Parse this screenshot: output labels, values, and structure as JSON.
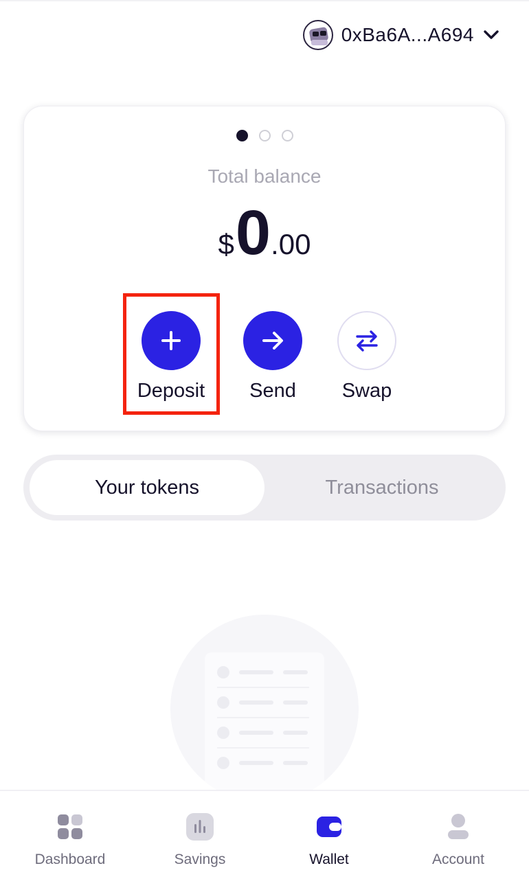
{
  "header": {
    "wallet_address": "0xBa6A...A694",
    "avatar_icon": "nft-avatar-icon",
    "dropdown_icon": "chevron-down-icon"
  },
  "balance_card": {
    "carousel_pages": 3,
    "carousel_active": 1,
    "label": "Total balance",
    "currency": "$",
    "integer": "0",
    "decimal": ".00",
    "actions": [
      {
        "label": "Deposit",
        "icon": "plus-icon"
      },
      {
        "label": "Send",
        "icon": "arrow-right-icon"
      },
      {
        "label": "Swap",
        "icon": "swap-arrows-icon"
      }
    ]
  },
  "tabs": {
    "items": [
      {
        "label": "Your tokens",
        "active": true
      },
      {
        "label": "Transactions",
        "active": false
      }
    ]
  },
  "bottom_nav": {
    "items": [
      {
        "label": "Dashboard",
        "icon": "grid-icon",
        "active": false
      },
      {
        "label": "Savings",
        "icon": "bar-chart-icon",
        "active": false
      },
      {
        "label": "Wallet",
        "icon": "wallet-icon",
        "active": true
      },
      {
        "label": "Account",
        "icon": "user-icon",
        "active": false
      }
    ]
  },
  "colors": {
    "accent": "#2b22e3",
    "text_primary": "#16122b",
    "text_muted": "#a9a8b3",
    "highlight": "#f4230e"
  }
}
